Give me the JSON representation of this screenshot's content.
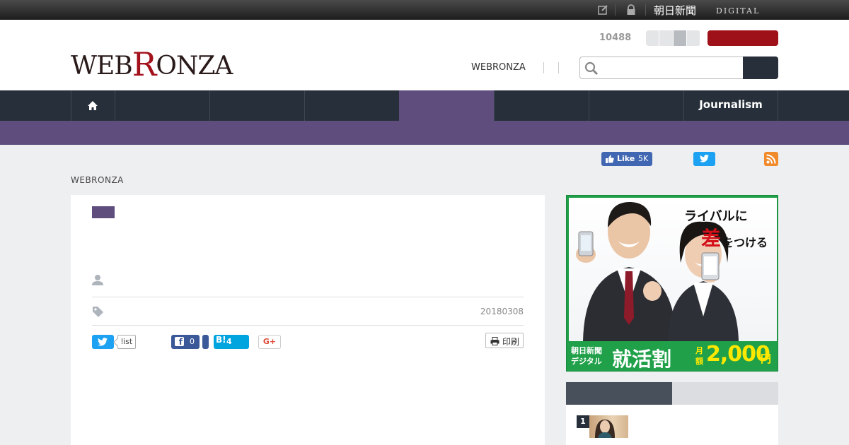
{
  "topbar": {
    "brand": "朝日新聞",
    "brand_sub": "DIGITAL",
    "icons": [
      "edit-icon",
      "lock-icon"
    ]
  },
  "header": {
    "logo_prefix": "WEB",
    "logo_r": "R",
    "logo_suffix": "ONZA",
    "counter": "10488",
    "nav_link": "WEBRONZA",
    "search": {
      "placeholder": ""
    }
  },
  "nav": {
    "items": [
      {
        "label": "",
        "icon": "home-icon"
      },
      {
        "label": ""
      },
      {
        "label": ""
      },
      {
        "label": ""
      },
      {
        "label": "",
        "active": true
      },
      {
        "label": ""
      },
      {
        "label": "Journalism"
      }
    ],
    "accent": "#5f4d7e"
  },
  "social": {
    "fb_like_label": "Like",
    "fb_like_count": "5K"
  },
  "breadcrumb": "WEBRONZA",
  "article": {
    "date": "20180308",
    "share": {
      "tw_count_label": "list",
      "fb_count": "0",
      "hatena_label": "B!",
      "hatena_count": "4",
      "gplus_label": "G+"
    },
    "print_label": "印刷"
  },
  "ad": {
    "headline_1": "ライバルに",
    "headline_2a": "差",
    "headline_2b": "をつける",
    "bottom_1": "朝日新聞 デジタル",
    "bottom_2": "就活割",
    "bottom_3": "月額",
    "bottom_4": "2,000",
    "bottom_5": "円"
  },
  "ranking": {
    "items": [
      {
        "rank": "1"
      }
    ]
  }
}
